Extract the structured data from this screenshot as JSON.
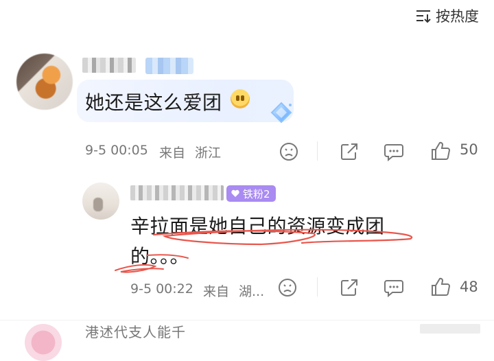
{
  "sort": {
    "label": "按热度"
  },
  "comment1": {
    "text": "她还是这么爱团",
    "time": "9-5 00:05",
    "source_prefix": "来自",
    "location": "浙江",
    "likes": "50"
  },
  "reply1": {
    "fan_badge": "铁粉2",
    "line1": "辛拉面是她自己的资源变成团",
    "line2": "的。。。",
    "time": "9-5 00:22",
    "source_prefix": "来自",
    "location": "湖...",
    "likes": "48"
  },
  "comment3": {
    "name_partial": "港述代支人能千"
  },
  "colors": {
    "bubble": "#eef3ff",
    "fan_badge": "#a98bf1",
    "scribble": "#e8564c",
    "meta": "#777777"
  },
  "icons": [
    "sort-icon",
    "crying-emoji-icon",
    "diamond-badge-icon",
    "dislike-face-icon",
    "share-icon",
    "comment-icon",
    "thumbs-up-icon",
    "heart-icon"
  ]
}
